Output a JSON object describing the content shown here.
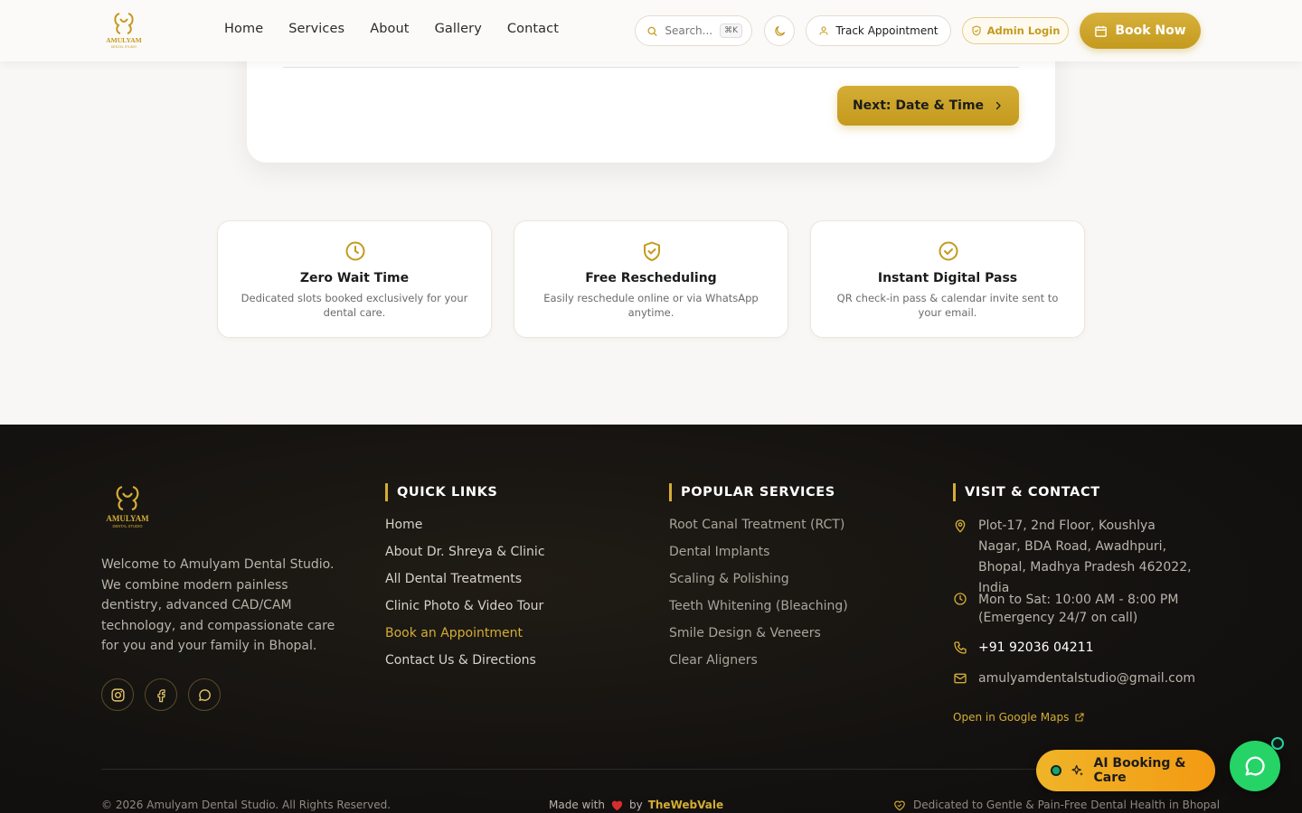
{
  "header": {
    "logo_text": "AMULYAM",
    "logo_sub": "DENTAL STUDIO",
    "nav": [
      {
        "label": "Home"
      },
      {
        "label": "Services"
      },
      {
        "label": "About"
      },
      {
        "label": "Gallery"
      },
      {
        "label": "Contact"
      }
    ],
    "search_placeholder": "Search...",
    "search_shortcut": "⌘K",
    "track_label": "Track Appointment",
    "admin_label": "Admin Login",
    "book_label": "Book Now"
  },
  "booking": {
    "next_label": "Next: Date & Time"
  },
  "features": [
    {
      "title": "Zero Wait Time",
      "desc": "Dedicated slots booked exclusively for your dental care.",
      "icon": "clock-icon"
    },
    {
      "title": "Free Rescheduling",
      "desc": "Easily reschedule online or via WhatsApp anytime.",
      "icon": "shield-check-icon"
    },
    {
      "title": "Instant Digital Pass",
      "desc": "QR check-in pass & calendar invite sent to your email.",
      "icon": "check-circle-icon"
    }
  ],
  "footer": {
    "logo_text": "AMULYAM",
    "logo_sub": "DENTAL STUDIO",
    "about": "Welcome to Amulyam Dental Studio. We combine modern painless dentistry, advanced CAD/CAM technology, and compassionate care for you and your family in Bhopal.",
    "quick_links_title": "QUICK LINKS",
    "quick_links": [
      {
        "label": "Home"
      },
      {
        "label": "About Dr. Shreya & Clinic"
      },
      {
        "label": "All Dental Treatments"
      },
      {
        "label": "Clinic Photo & Video Tour"
      },
      {
        "label": "Book an Appointment"
      },
      {
        "label": "Contact Us & Directions"
      }
    ],
    "services_title": "POPULAR SERVICES",
    "services": [
      {
        "label": "Root Canal Treatment (RCT)"
      },
      {
        "label": "Dental Implants"
      },
      {
        "label": "Scaling & Polishing"
      },
      {
        "label": "Teeth Whitening (Bleaching)"
      },
      {
        "label": "Smile Design & Veneers"
      },
      {
        "label": "Clear Aligners"
      }
    ],
    "contact_title": "VISIT & CONTACT",
    "address": "Plot-17, 2nd Floor, Koushlya Nagar, BDA Road, Awadhpuri, Bhopal, Madhya Pradesh 462022, India",
    "hours": "Mon to Sat: 10:00 AM - 8:00 PM (Emergency 24/7 on call)",
    "phone": "+91 92036 04211",
    "email": "amulyamdentalstudio@gmail.com",
    "maps_label": "Open in Google Maps",
    "copyright": "© 2026 Amulyam Dental Studio. All Rights Reserved.",
    "made_with": "Made with",
    "by": "by",
    "brand": "TheWebVale",
    "dedicated": "Dedicated to Gentle & Pain-Free Dental Health in Bhopal"
  },
  "floating": {
    "ai_label": "AI Booking & Care"
  },
  "colors": {
    "gold": "#c49a1e",
    "gold_light": "#d4ad35",
    "footer_bg": "#141210",
    "whatsapp": "#25d366"
  }
}
